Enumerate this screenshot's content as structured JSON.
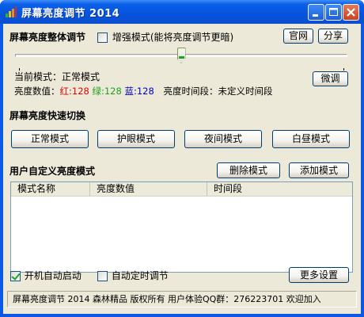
{
  "window": {
    "title": "屏幕亮度调节 2014"
  },
  "header": {
    "section_title": "屏幕亮度整体调节",
    "enhanced_mode_label": "增强模式(能将亮度调节更暗)",
    "enhanced_mode_checked": false,
    "website_button": "官网",
    "share_button": "分享"
  },
  "slider": {
    "value_fraction": 0.5
  },
  "status": {
    "current_mode_label": "当前模式：",
    "current_mode_value": "正常模式",
    "brightness_label": "亮度数值：",
    "red_label": "红:",
    "red_value": "128",
    "green_label": "绿:",
    "green_value": "128",
    "blue_label": "蓝:",
    "blue_value": "128",
    "time_period_label": "亮度时间段：",
    "time_period_value": "未定义时间段",
    "fine_tune_button": "微调"
  },
  "quick_switch": {
    "title": "屏幕亮度快速切换",
    "buttons": [
      "正常模式",
      "护眼模式",
      "夜间模式",
      "白昼模式"
    ]
  },
  "custom": {
    "title": "用户自定义亮度模式",
    "delete_button": "删除模式",
    "add_button": "添加模式",
    "columns": [
      "模式名称",
      "亮度数值",
      "时间段"
    ]
  },
  "footer": {
    "autostart_label": "开机自动启动",
    "autostart_checked": true,
    "timer_label": "自动定时调节",
    "timer_checked": false,
    "more_settings_button": "更多设置",
    "status_text": "屏幕亮度调节 2014 森林精品 版权所有 用户体验QQ群：276223701 欢迎加入"
  },
  "colors": {
    "titlebar": "#0a5fe8",
    "client_bg": "#ece9d8",
    "red": "#e00000",
    "green": "#20a020",
    "blue": "#0000c0"
  }
}
